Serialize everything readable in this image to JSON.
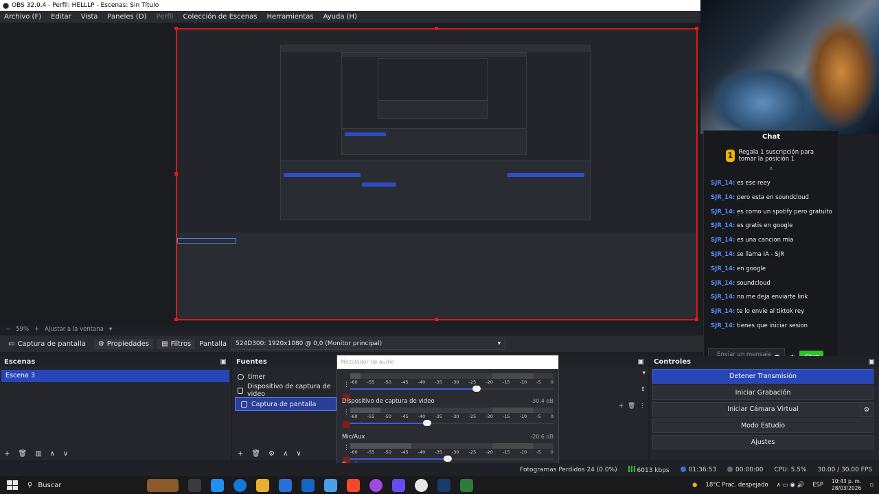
{
  "window": {
    "title": "OBS 32.0.4 - Perfil: HELLLP - Escenas: Sin Título"
  },
  "menu": [
    {
      "label": "Archivo (F)",
      "enabled": true
    },
    {
      "label": "Editar",
      "enabled": true
    },
    {
      "label": "Vista",
      "enabled": true
    },
    {
      "label": "Paneles (D)",
      "enabled": true
    },
    {
      "label": "Perfil",
      "enabled": false
    },
    {
      "label": "Colección de Escenas",
      "enabled": true
    },
    {
      "label": "Herramientas",
      "enabled": true
    },
    {
      "label": "Ayuda (H)",
      "enabled": true
    }
  ],
  "chat": {
    "title": "Chat",
    "gift_icon": "1",
    "gift_text": "Regala 1 suscripción para tomar la posición 1",
    "messages": [
      {
        "user": "SJR_14:",
        "text": "es ese reey"
      },
      {
        "user": "SJR_14:",
        "text": "pero esta en soundcloud"
      },
      {
        "user": "SJR_14:",
        "text": "es como un spotify pero gratuito"
      },
      {
        "user": "SJR_14:",
        "text": "es gratis en google"
      },
      {
        "user": "SJR_14:",
        "text": "es una cancion mia"
      },
      {
        "user": "SJR_14:",
        "text": "se llama IA - SJR"
      },
      {
        "user": "SJR_14:",
        "text": "en google"
      },
      {
        "user": "SJR_14:",
        "text": "soundcloud"
      },
      {
        "user": "SJR_14:",
        "text": "no me deja enviarte link"
      },
      {
        "user": "SJR_14:",
        "text": "te lo envie al tiktok rey"
      },
      {
        "user": "SJR_14:",
        "text": "tienes que iniciar sesion"
      }
    ],
    "input_placeholder": "Enviar un mensaje",
    "send_label": "Chat"
  },
  "zoom": {
    "value": "59%",
    "fit_label": "Ajustar a la ventana"
  },
  "source_toolbar": {
    "source_name": "Captura de pantalla",
    "properties_label": "Propiedades",
    "filters_label": "Filtros",
    "display_label": "Pantalla",
    "display_value": "524D300: 1920x1080 @ 0,0 (Monitor principal)"
  },
  "scenes": {
    "title": "Escenas",
    "items": [
      "Escena 3"
    ]
  },
  "sources": {
    "title": "Fuentes",
    "items": [
      "timer",
      "Dispositivo de captura de video",
      "Captura de pantalla"
    ]
  },
  "mixer": {
    "title": "Mezclador de audio",
    "scale": [
      "-60",
      "-55",
      "-50",
      "-45",
      "-40",
      "-35",
      "-30",
      "-25",
      "-20",
      "-15",
      "-10",
      "-5",
      "0"
    ],
    "tracks": [
      {
        "name": "",
        "db": "",
        "level": 0.05,
        "fader": 0.62
      },
      {
        "name": "Dispositivo de captura de video",
        "db": "-30.4 dB",
        "level": 0.15,
        "fader": 0.38
      },
      {
        "name": "Mic/Aux",
        "db": "-20.6 dB",
        "level": 0.3,
        "fader": 0.48
      }
    ]
  },
  "controls": {
    "title": "Controles",
    "buttons": [
      "Detener Transmisión",
      "Iniciar Grabación",
      "Iniciar Cámara Virtual",
      "Modo Estudio",
      "Ajustes"
    ]
  },
  "status": {
    "dropped": "Fotogramas Perdidos 24 (0.0%)",
    "bitrate": "6013 kbps",
    "stream_time": "01:36:53",
    "rec_time": "00:00:00",
    "cpu": "CPU: 5.5%",
    "fps": "30.00 / 30.00 FPS"
  },
  "taskbar": {
    "search_label": "Buscar",
    "weather": "18°C  Prac. despejado",
    "lang": "ESP",
    "time": "10:43 p. m.",
    "date": "28/03/2026"
  },
  "colors": {
    "accent": "#2846b8",
    "selection_border": "#d11d1d",
    "chat_user": "#5a8dff",
    "send_button": "#2fc12f"
  }
}
